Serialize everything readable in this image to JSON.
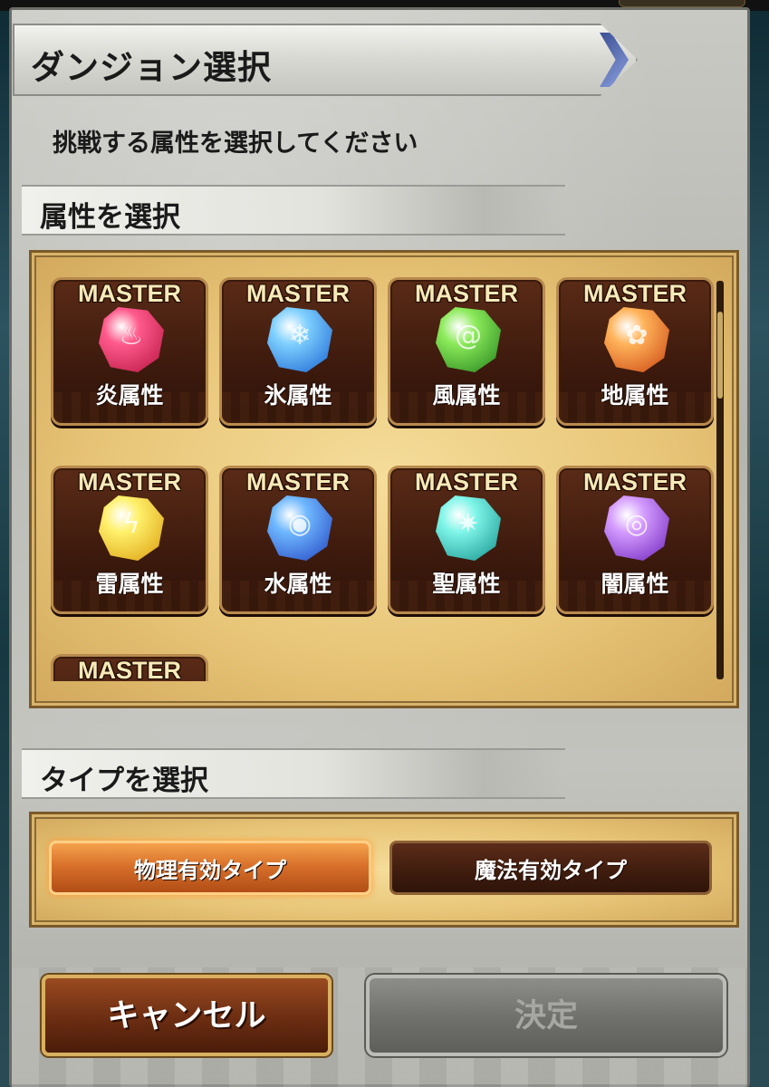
{
  "window": {
    "title": "ダンジョン選択",
    "instruction": "挑戦する属性を選択してください"
  },
  "attribute_section": {
    "heading": "属性を選択",
    "master_badge": "MASTER",
    "items": [
      {
        "label": "炎属性",
        "icon": "fire-gem-icon",
        "glyph": "♨",
        "color_from": "#ff5a8c",
        "color_to": "#b3123e",
        "row": 0,
        "col": 0
      },
      {
        "label": "氷属性",
        "icon": "ice-gem-icon",
        "glyph": "❄",
        "color_from": "#7fd0ff",
        "color_to": "#1560d0",
        "row": 0,
        "col": 1
      },
      {
        "label": "風属性",
        "icon": "wind-gem-icon",
        "glyph": "@",
        "color_from": "#8cea5a",
        "color_to": "#1f7f1a",
        "row": 0,
        "col": 2
      },
      {
        "label": "地属性",
        "icon": "earth-gem-icon",
        "glyph": "✿",
        "color_from": "#ffb35a",
        "color_to": "#c9420f",
        "row": 0,
        "col": 3
      },
      {
        "label": "雷属性",
        "icon": "thunder-gem-icon",
        "glyph": "ϟ",
        "color_from": "#fff06a",
        "color_to": "#d99a0a",
        "row": 1,
        "col": 0
      },
      {
        "label": "水属性",
        "icon": "water-gem-icon",
        "glyph": "◉",
        "color_from": "#6fb8ff",
        "color_to": "#1f3fbf",
        "row": 1,
        "col": 1
      },
      {
        "label": "聖属性",
        "icon": "holy-gem-icon",
        "glyph": "✷",
        "color_from": "#7ff5e8",
        "color_to": "#0f8f8a",
        "row": 1,
        "col": 2
      },
      {
        "label": "闇属性",
        "icon": "dark-gem-icon",
        "glyph": "◎",
        "color_from": "#d49bff",
        "color_to": "#6a1fb8",
        "row": 1,
        "col": 3
      }
    ]
  },
  "type_section": {
    "heading": "タイプを選択",
    "options": [
      {
        "label": "物理有効タイプ",
        "selected": true
      },
      {
        "label": "魔法有効タイプ",
        "selected": false
      }
    ]
  },
  "footer": {
    "cancel_label": "キャンセル",
    "decide_label": "決定",
    "decide_enabled": false
  },
  "colors": {
    "accent_orange": "#d9712b",
    "card_brown": "#3d1a0d",
    "parchment": "#e8c679"
  }
}
